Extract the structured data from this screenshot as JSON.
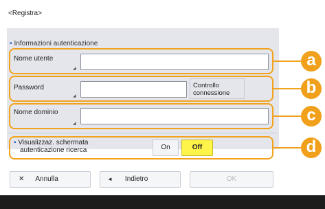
{
  "page_title": "<Registra>",
  "section_title": "Informazioni autenticazione",
  "rows": {
    "username": {
      "label": "Nome utente"
    },
    "password": {
      "label": "Password"
    },
    "domain": {
      "label": "Nome dominio"
    }
  },
  "control_connection": {
    "line1": "Controllo",
    "line2": "connessione"
  },
  "auth_screen": {
    "line1": "Visualizzaz. schermata",
    "line2": "autenticazione ricerca",
    "on": "On",
    "off": "Off",
    "selected": "Off"
  },
  "footer": {
    "cancel": "Annulla",
    "back": "Indietro",
    "ok": "OK"
  },
  "callouts": [
    "a",
    "b",
    "c",
    "d"
  ],
  "icons": {
    "close": "✕",
    "back": "◄",
    "bullet": "▪"
  },
  "colors": {
    "highlight": "#f2a21c",
    "selected": "#fff44a",
    "panel": "#e4e6ec"
  }
}
